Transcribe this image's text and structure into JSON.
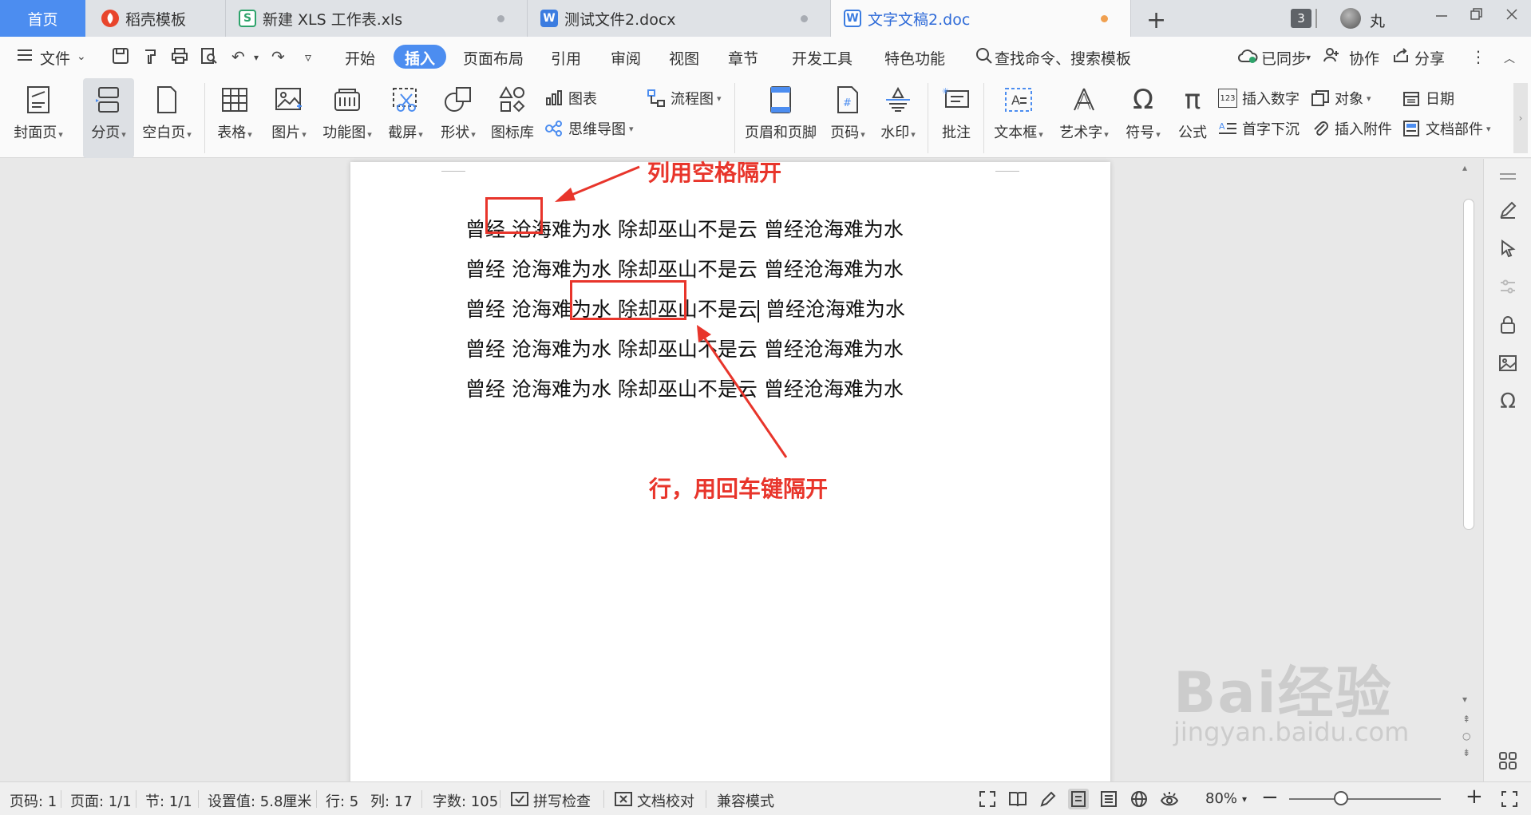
{
  "tabs": {
    "home": "首页",
    "daoke": "稻壳模板",
    "xls": "新建 XLS 工作表.xls",
    "docx": "测试文件2.docx",
    "active": "文字文稿2.doc",
    "count": "3",
    "user": "丸"
  },
  "menu": {
    "file": "文件",
    "items": [
      "开始",
      "插入",
      "页面布局",
      "引用",
      "审阅",
      "视图",
      "章节",
      "开发工具",
      "特色功能"
    ],
    "search_placeholder": "查找命令、搜索模板",
    "sync": "已同步",
    "collab": "协作",
    "share": "分享"
  },
  "ribbon": {
    "cover": "封面页",
    "pagebreak": "分页",
    "blank": "空白页",
    "table": "表格",
    "picture": "图片",
    "funcchart": "功能图",
    "screenshot": "截屏",
    "shape": "形状",
    "iconlib": "图标库",
    "chart": "图表",
    "mindmap": "思维导图",
    "flowchart": "流程图",
    "header_footer": "页眉和页脚",
    "pagenum": "页码",
    "watermark": "水印",
    "comment": "批注",
    "textbox": "文本框",
    "wordart": "艺术字",
    "symbol": "符号",
    "formula": "公式",
    "insert_number": "插入数字",
    "dropcap": "首字下沉",
    "object": "对象",
    "attachment": "插入附件",
    "date": "日期",
    "docpart": "文档部件"
  },
  "document": {
    "lines": [
      "曾经 沧海难为水 除却巫山不是云 曾经沧海难为水",
      "曾经 沧海难为水 除却巫山不是云 曾经沧海难为水",
      "曾经 沧海难为水 除却巫山不是云",
      "曾经 沧海难为水 除却巫山不是云 曾经沧海难为水",
      "曾经 沧海难为水 除却巫山不是云 曾经沧海难为水"
    ],
    "line3_tail": " 曾经沧海难为水",
    "annotation_column": "列用空格隔开",
    "annotation_row": "行，用回车键隔开"
  },
  "status": {
    "page": "页码: 1",
    "pages": "页面: 1/1",
    "section": "节: 1/1",
    "setting": "设置值: 5.8厘米",
    "row": "行: 5",
    "col": "列: 17",
    "words": "字数: 105",
    "spellcheck": "拼写检查",
    "proofread": "文档校对",
    "compat": "兼容模式",
    "zoom": "80%"
  },
  "zoom_level_fraction": 0.34,
  "watermark": {
    "brand": "Bai经验",
    "url": "jingyan.baidu.com"
  },
  "colors": {
    "accent": "#4c8df0",
    "annotation_red": "#e8352b",
    "active_tab_text": "#2f6bd8"
  }
}
